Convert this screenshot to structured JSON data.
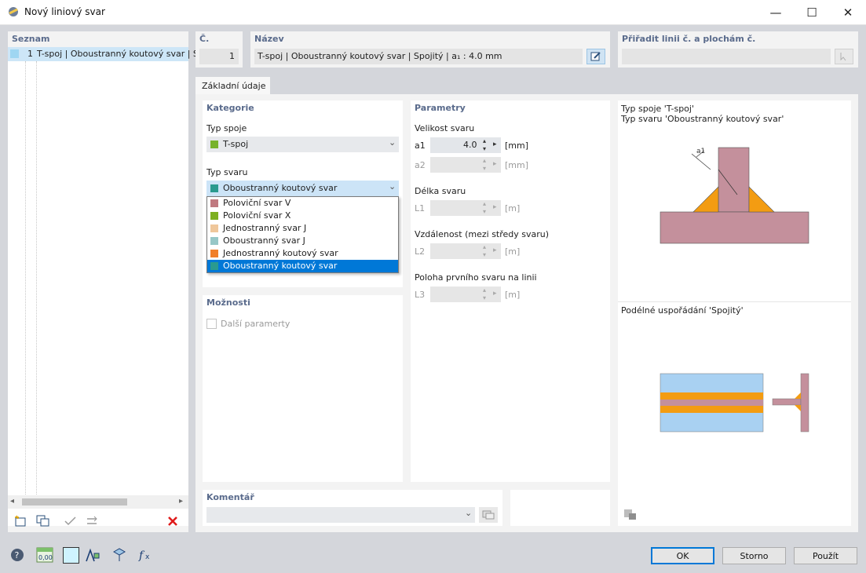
{
  "window": {
    "title": "Nový liniový svar",
    "minimize": "—",
    "maximize": "☐",
    "close": "✕"
  },
  "list": {
    "header": "Seznam",
    "items": [
      {
        "no": "1",
        "text": "T-spoj | Oboustranný koutový svar | S"
      }
    ]
  },
  "number": {
    "label": "Č.",
    "value": "1"
  },
  "name": {
    "label": "Název",
    "value": "T-spoj | Oboustranný koutový svar | Spojitý | a₁ : 4.0 mm"
  },
  "assign": {
    "label": "Přiřadit linii č. a plochám č.",
    "value": ""
  },
  "tabs": [
    {
      "label": "Základní údaje"
    }
  ],
  "category": {
    "header": "Kategorie",
    "joint_type_label": "Typ spoje",
    "joint_type_value": "T-spoj",
    "weld_type_label": "Typ svaru",
    "weld_type_value": "Oboustranný koutový svar",
    "weld_options": [
      {
        "label": "Poloviční svar V",
        "color": "#c07a80"
      },
      {
        "label": "Poloviční svar X",
        "color": "#7db021"
      },
      {
        "label": "Jednostranný svar J",
        "color": "#efc79b"
      },
      {
        "label": "Oboustranný svar J",
        "color": "#97c7c7"
      },
      {
        "label": "Jednostranný koutový svar",
        "color": "#f07f2a"
      },
      {
        "label": "Oboustranný koutový svar",
        "color": "#2a9a8f"
      }
    ],
    "joint_color": "#77b22b",
    "weld_color": "#2a9a8f"
  },
  "options": {
    "header": "Možnosti",
    "more_params": "Další paramerty"
  },
  "params": {
    "header": "Parametry",
    "size_label": "Velikost svaru",
    "a1": {
      "sym": "a1",
      "value": "4.0",
      "unit": "[mm]"
    },
    "a2": {
      "sym": "a2",
      "value": "",
      "unit": "[mm]"
    },
    "length_label": "Délka svaru",
    "L1": {
      "sym": "L1",
      "value": "",
      "unit": "[m]"
    },
    "spacing_label": "Vzdálenost (mezi středy svaru)",
    "L2": {
      "sym": "L2",
      "value": "",
      "unit": "[m]"
    },
    "position_label": "Poloha prvního svaru na linii",
    "L3": {
      "sym": "L3",
      "value": "",
      "unit": "[m]"
    }
  },
  "preview": {
    "line1": "Typ spoje 'T-spoj'",
    "line2": "Typ svaru 'Oboustranný koutový svar'",
    "dim_label": "a1",
    "arrangement": "Podélné uspořádání 'Spojitý'"
  },
  "comment": {
    "header": "Komentář",
    "value": ""
  },
  "buttons": {
    "ok": "OK",
    "cancel": "Storno",
    "apply": "Použít"
  },
  "colors": {
    "accent": "#0078d7",
    "header": "#5a6b8c",
    "steel": "#c4909c",
    "weld": "#f39c12",
    "plate": "#a9d1f2"
  }
}
